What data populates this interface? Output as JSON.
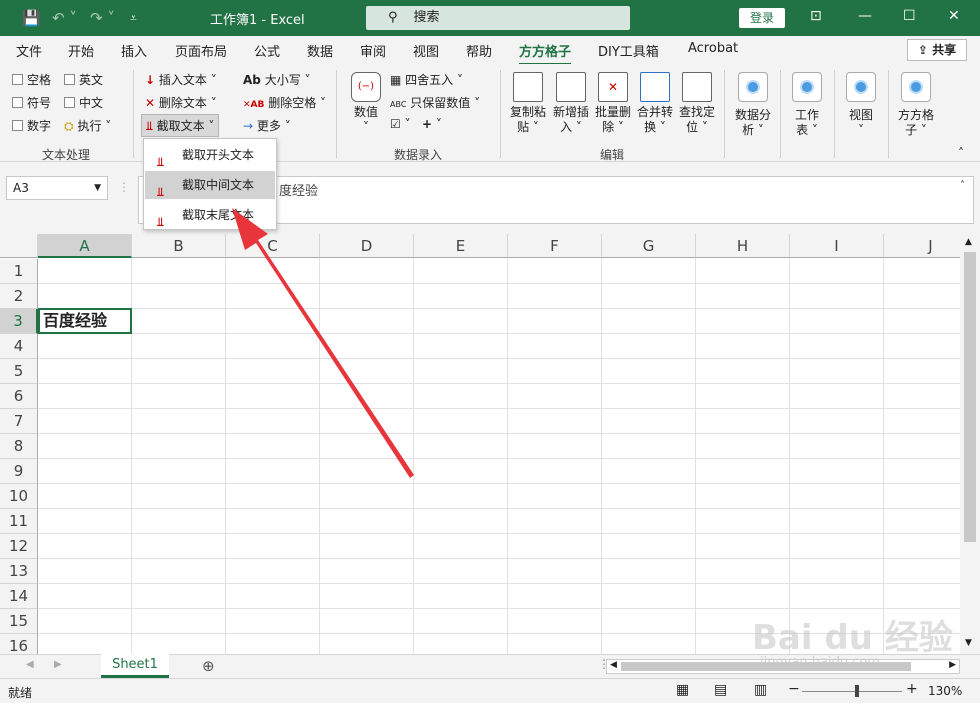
{
  "titlebar": {
    "title": "工作簿1  -  Excel",
    "search": "搜索",
    "login": "登录",
    "save_icon": "save-icon",
    "undo_icon": "undo-icon"
  },
  "tabs": [
    "文件",
    "开始",
    "插入",
    "页面布局",
    "公式",
    "数据",
    "审阅",
    "视图",
    "帮助",
    "方方格子",
    "DIY工具箱",
    "Acrobat"
  ],
  "share_label": "共享",
  "ribbon": {
    "text_group": {
      "checkboxes": [
        "空格",
        "英文",
        "符号",
        "中文",
        "数字"
      ],
      "exec": "执行",
      "label": "文本处理"
    },
    "insert_text": "插入文本",
    "delete_text": "删除文本",
    "extract_text": "截取文本",
    "case": "大小写",
    "delete_space": "删除空格",
    "more": "更多",
    "numeric": "数值",
    "round": "四舍五入",
    "keep_value": "只保留数值",
    "entry_label": "数据录入",
    "copy_paste": [
      "复制粘",
      "贴"
    ],
    "new_insert": [
      "新增插",
      "入"
    ],
    "batch_delete": [
      "批量删",
      "除"
    ],
    "merge_convert": [
      "合并转",
      "换"
    ],
    "find_locate": [
      "查找定",
      "位"
    ],
    "edit_label": "编辑",
    "data_analysis": [
      "数据分",
      "析"
    ],
    "worksheet": [
      "工作",
      "表"
    ],
    "view": "视图",
    "ffgz": [
      "方方格",
      "子"
    ]
  },
  "dropdown": [
    "截取开头文本",
    "截取中间文本",
    "截取末尾文本"
  ],
  "formula": {
    "namebox": "A3",
    "content": "度经验"
  },
  "columns": [
    "A",
    "B",
    "C",
    "D",
    "E",
    "F",
    "G",
    "H",
    "I",
    "J"
  ],
  "rows": [
    "1",
    "2",
    "3",
    "4",
    "5",
    "6",
    "7",
    "8",
    "9",
    "10",
    "11",
    "12",
    "13",
    "14",
    "15",
    "16"
  ],
  "cell_A3": "百度经验",
  "sheet": "Sheet1",
  "status": {
    "ready": "就绪",
    "zoom": "130%"
  },
  "watermark": {
    "brand": "Bai du 经验",
    "url": "jingyan.baidu.com"
  }
}
